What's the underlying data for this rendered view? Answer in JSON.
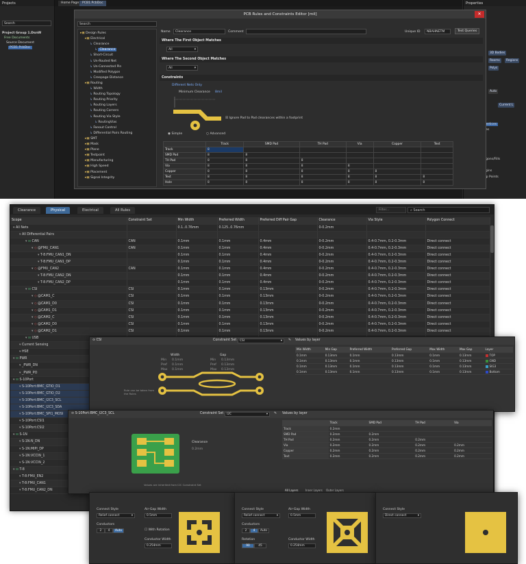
{
  "top": {
    "projects_title": "Projects",
    "project_search": "Search",
    "project_tree": [
      "Project Group 1.DsnW",
      "Free Documents",
      "Source Document",
      "PCB1.PcbDoc"
    ],
    "doc_tabs": [
      "Home Page",
      "PCB1.PcbDoc"
    ],
    "properties_title": "Properties",
    "props_buttons": [
      "3D Bodies",
      "Rooms",
      "Regions",
      "Polys",
      "Other",
      "Auto",
      "Current L"
    ],
    "props_section": "Snapping",
    "props_list": [
      "Objects",
      "Track/Arcs Vertices",
      "Track/Arc Lines",
      "Pad Centers",
      "Pad Vertices",
      "Pad Edges",
      "Via Centers",
      "Regions/Polygons/Fills",
      "Board Shape",
      "Footprint Origins",
      "3D Body Snap Points",
      "Texts"
    ],
    "dialog": {
      "title": "PCB Rules and Constraints Editor [mil]",
      "close": "✕",
      "search": "Search",
      "tree": [
        "Design Rules",
        "Electrical",
        "Clearance",
        "Clearance",
        "Short-Circuit",
        "Un-Routed Net",
        "Un-Connected Pin",
        "Modified Polygon",
        "Creepage Distance",
        "Routing",
        "Width",
        "Routing Topology",
        "Routing Priority",
        "Routing Layers",
        "Routing Corners",
        "Routing Via Style",
        "RoutingVias",
        "Fanout Control",
        "Differential Pairs Routing",
        "SMT",
        "Mask",
        "Plane",
        "Testpoint",
        "Manufacturing",
        "High Speed",
        "Placement",
        "Signal Integrity"
      ],
      "name_label": "Name",
      "name_value": "Clearance",
      "comment_label": "Comment",
      "uid_label": "Unique ID",
      "uid_value": "NBAHNETM",
      "test_queries": "Test Queries",
      "first_match_title": "Where The First Object Matches",
      "first_match_value": "All",
      "second_match_title": "Where The Second Object Matches",
      "second_match_value": "All",
      "constraints_title": "Constraints",
      "diff_nets": "Different Nets Only",
      "min_clearance_label": "Minimum Clearance",
      "min_clearance_value": "8mil",
      "ignore_pad": "Ignore Pad to Pad clearances within a footprint",
      "mode_simple": "Simple",
      "mode_advanced": "Advanced",
      "table_cols": [
        "",
        "Track",
        "SMD Pad",
        "TH Pad",
        "Via",
        "Copper",
        "Text"
      ],
      "table_rows": [
        [
          "Track",
          "8",
          "",
          "",
          "",
          "",
          ""
        ],
        [
          "SMD Pad",
          "8",
          "8",
          "",
          "",
          "",
          ""
        ],
        [
          "TH Pad",
          "8",
          "8",
          "8",
          "",
          "",
          ""
        ],
        [
          "Via",
          "8",
          "8",
          "8",
          "8",
          "",
          ""
        ],
        [
          "Copper",
          "8",
          "8",
          "8",
          "8",
          "8",
          ""
        ],
        [
          "Text",
          "8",
          "8",
          "8",
          "8",
          "8",
          "8"
        ],
        [
          "Hole",
          "8",
          "8",
          "8",
          "8",
          "8",
          "8"
        ]
      ]
    }
  },
  "cm": {
    "tabs": [
      "Clearance",
      "Physical",
      "Electrical",
      "All Rules"
    ],
    "active_tab": "Physical",
    "search": "Search",
    "filter": "Filter...",
    "columns": [
      "Scope",
      "Constraint Set",
      "Min Width",
      "Preferred Width",
      "Preferred Diff Pair Gap",
      "Clearance",
      "Via Style",
      "Polygon Connect"
    ],
    "rows": [
      {
        "d": 0,
        "icon": "",
        "name": "All Nets",
        "cs": "",
        "mw": "0.1..0.76mm",
        "pw": "0.125..0.76mm",
        "gap": "",
        "cl": "0-0.2mm",
        "via": "",
        "pc": ""
      },
      {
        "d": 1,
        "icon": "",
        "name": "All Differential Pairs",
        "cs": "",
        "mw": "",
        "pw": "",
        "gap": "",
        "cl": "",
        "via": "",
        "pc": ""
      },
      {
        "d": 2,
        "icon": "grp",
        "name": "CAN",
        "cs": "CAN",
        "mw": "0.1mm",
        "pw": "0.1mm",
        "gap": "0.4mm",
        "cl": "0-0.2mm",
        "via": "0.4-0.7mm, 0.2-0.3mm",
        "pc": "Direct connect"
      },
      {
        "d": 3,
        "icon": "dif",
        "name": "@FMU_CAN1",
        "cs": "CAN",
        "mw": "0.1mm",
        "pw": "0.1mm",
        "gap": "0.4mm",
        "cl": "0-0.2mm",
        "via": "0.4-0.7mm, 0.2-0.3mm",
        "pc": "Direct connect"
      },
      {
        "d": 4,
        "icon": "",
        "name": "T-8:FMU_CAN1_DN",
        "cs": "",
        "mw": "0.1mm",
        "pw": "0.1mm",
        "gap": "0.4mm",
        "cl": "0-0.2mm",
        "via": "0.4-0.7mm, 0.2-0.3mm",
        "pc": "Direct connect"
      },
      {
        "d": 4,
        "icon": "",
        "name": "T-8:FMU_CAN1_DP",
        "cs": "",
        "mw": "0.1mm",
        "pw": "0.1mm",
        "gap": "0.4mm",
        "cl": "0-0.2mm",
        "via": "0.4-0.7mm, 0.2-0.3mm",
        "pc": "Direct connect"
      },
      {
        "d": 3,
        "icon": "dif",
        "name": "@FMU_CAN2",
        "cs": "CAN",
        "mw": "0.1mm",
        "pw": "0.1mm",
        "gap": "0.4mm",
        "cl": "0-0.2mm",
        "via": "0.4-0.7mm, 0.2-0.3mm",
        "pc": "Direct connect"
      },
      {
        "d": 4,
        "icon": "",
        "name": "T-8:FMU_CAN2_DN",
        "cs": "",
        "mw": "0.1mm",
        "pw": "0.1mm",
        "gap": "0.4mm",
        "cl": "0-0.2mm",
        "via": "0.4-0.7mm, 0.2-0.3mm",
        "pc": "Direct connect"
      },
      {
        "d": 4,
        "icon": "",
        "name": "T-8:FMU_CAN2_DP",
        "cs": "",
        "mw": "0.1mm",
        "pw": "0.1mm",
        "gap": "0.4mm",
        "cl": "0-0.2mm",
        "via": "0.4-0.7mm, 0.2-0.3mm",
        "pc": "Direct connect"
      },
      {
        "d": 2,
        "icon": "grp",
        "name": "CSI",
        "cs": "CSI",
        "mw": "0.1mm",
        "pw": "0.1mm",
        "gap": "0.13mm",
        "cl": "0-0.2mm",
        "via": "0.4-0.7mm, 0.2-0.3mm",
        "pc": "Direct connect"
      },
      {
        "d": 3,
        "icon": "dif",
        "name": "@CAM1_C",
        "cs": "CSI",
        "mw": "0.1mm",
        "pw": "0.1mm",
        "gap": "0.13mm",
        "cl": "0-0.2mm",
        "via": "0.4-0.7mm, 0.2-0.3mm",
        "pc": "Direct connect"
      },
      {
        "d": 3,
        "icon": "dif",
        "name": "@CAM1_D0",
        "cs": "CSI",
        "mw": "0.1mm",
        "pw": "0.1mm",
        "gap": "0.13mm",
        "cl": "0-0.2mm",
        "via": "0.4-0.7mm, 0.2-0.3mm",
        "pc": "Direct connect"
      },
      {
        "d": 3,
        "icon": "dif",
        "name": "@CAM1_D1",
        "cs": "CSI",
        "mw": "0.1mm",
        "pw": "0.1mm",
        "gap": "0.13mm",
        "cl": "0-0.2mm",
        "via": "0.4-0.7mm, 0.2-0.3mm",
        "pc": "Direct connect"
      },
      {
        "d": 3,
        "icon": "dif",
        "name": "@CAM2_C",
        "cs": "CSI",
        "mw": "0.1mm",
        "pw": "0.1mm",
        "gap": "0.13mm",
        "cl": "0-0.2mm",
        "via": "0.4-0.7mm, 0.2-0.3mm",
        "pc": "Direct connect"
      },
      {
        "d": 3,
        "icon": "dif",
        "name": "@CAM2_D0",
        "cs": "CSI",
        "mw": "0.1mm",
        "pw": "0.1mm",
        "gap": "0.13mm",
        "cl": "0-0.2mm",
        "via": "0.4-0.7mm, 0.2-0.3mm",
        "pc": "Direct connect"
      },
      {
        "d": 3,
        "icon": "dif",
        "name": "@CAM2_D1",
        "cs": "CSI",
        "mw": "0.1mm",
        "pw": "0.1mm",
        "gap": "0.13mm",
        "cl": "0-0.2mm",
        "via": "0.4-0.7mm, 0.2-0.3mm",
        "pc": "Direct connect"
      },
      {
        "d": 2,
        "icon": "grp",
        "name": "USB",
        "cs": "",
        "mw": "",
        "pw": "",
        "gap": "",
        "cl": "",
        "via": "",
        "pc": ""
      },
      {
        "d": 1,
        "icon": "",
        "name": "Current Sensing",
        "cs": "",
        "mw": "",
        "pw": "",
        "gap": "",
        "cl": "",
        "via": "",
        "pc": ""
      },
      {
        "d": 1,
        "icon": "",
        "name": "HSE",
        "cs": "",
        "mw": "",
        "pw": "",
        "gap": "",
        "cl": "",
        "via": "",
        "pc": ""
      },
      {
        "d": 0,
        "icon": "grp",
        "name": "PWR",
        "cs": "",
        "mw": "",
        "pw": "",
        "gap": "",
        "cl": "",
        "via": "",
        "pc": ""
      },
      {
        "d": 1,
        "icon": "",
        "name": "_PWR_DN",
        "cs": "",
        "mw": "",
        "pw": "",
        "gap": "",
        "cl": "",
        "via": "",
        "pc": ""
      },
      {
        "d": 1,
        "icon": "",
        "name": "_PWR_PO",
        "cs": "",
        "mw": "",
        "pw": "",
        "gap": "",
        "cl": "",
        "via": "",
        "pc": ""
      },
      {
        "d": 0,
        "icon": "grp",
        "name": "S-10Port",
        "cs": "",
        "mw": "",
        "pw": "",
        "gap": "",
        "cl": "",
        "via": "",
        "pc": ""
      },
      {
        "d": 1,
        "icon": "",
        "name": "S-10Port:BMC_GTIO_D1",
        "cs": "",
        "mw": "",
        "pw": "",
        "gap": "",
        "cl": "",
        "via": "",
        "pc": "",
        "hl": true
      },
      {
        "d": 1,
        "icon": "",
        "name": "S-10Port:BMC_GTIO_D2",
        "cs": "",
        "mw": "",
        "pw": "",
        "gap": "",
        "cl": "",
        "via": "",
        "pc": "",
        "hl": true
      },
      {
        "d": 1,
        "icon": "",
        "name": "S-10Port:BMC_I2C3_SCL",
        "cs": "",
        "mw": "",
        "pw": "",
        "gap": "",
        "cl": "",
        "via": "",
        "pc": "",
        "hl": true
      },
      {
        "d": 1,
        "icon": "",
        "name": "S-10Port:BMC_I2C3_SDA",
        "cs": "",
        "mw": "",
        "pw": "",
        "gap": "",
        "cl": "",
        "via": "",
        "pc": "",
        "hl": true
      },
      {
        "d": 1,
        "icon": "",
        "name": "S-10Port:BMC_SPI1_MOSI",
        "cs": "",
        "mw": "",
        "pw": "",
        "gap": "",
        "cl": "",
        "via": "",
        "pc": "",
        "hl": true
      },
      {
        "d": 1,
        "icon": "",
        "name": "S-10Port:CSI1",
        "cs": "",
        "mw": "",
        "pw": "",
        "gap": "",
        "cl": "",
        "via": "",
        "pc": ""
      },
      {
        "d": 1,
        "icon": "",
        "name": "S-10Port:CSI2",
        "cs": "",
        "mw": "",
        "pw": "",
        "gap": "",
        "cl": "",
        "via": "",
        "pc": ""
      },
      {
        "d": 0,
        "icon": "grp",
        "name": "S-1N",
        "cs": "",
        "mw": "",
        "pw": "",
        "gap": "",
        "cl": "",
        "via": "",
        "pc": ""
      },
      {
        "d": 1,
        "icon": "",
        "name": "S-1N:N_DN",
        "cs": "",
        "mw": "",
        "pw": "",
        "gap": "",
        "cl": "",
        "via": "",
        "pc": ""
      },
      {
        "d": 1,
        "icon": "",
        "name": "S-1N:MIPI_DP",
        "cs": "",
        "mw": "",
        "pw": "",
        "gap": "",
        "cl": "",
        "via": "",
        "pc": ""
      },
      {
        "d": 1,
        "icon": "",
        "name": "S-1N:VCCIN_1",
        "cs": "",
        "mw": "",
        "pw": "",
        "gap": "",
        "cl": "",
        "via": "",
        "pc": ""
      },
      {
        "d": 1,
        "icon": "",
        "name": "S-1N:VCCIN_2",
        "cs": "",
        "mw": "",
        "pw": "",
        "gap": "",
        "cl": "",
        "via": "",
        "pc": ""
      },
      {
        "d": 0,
        "icon": "grp",
        "name": "T-8",
        "cs": "",
        "mw": "",
        "pw": "",
        "gap": "",
        "cl": "",
        "via": "",
        "pc": ""
      },
      {
        "d": 1,
        "icon": "",
        "name": "T-8:FMU_EN2",
        "cs": "",
        "mw": "",
        "pw": "",
        "gap": "",
        "cl": "",
        "via": "",
        "pc": ""
      },
      {
        "d": 1,
        "icon": "",
        "name": "T-8:FMU_CAN1",
        "cs": "",
        "mw": "",
        "pw": "",
        "gap": "",
        "cl": "",
        "via": "",
        "pc": ""
      },
      {
        "d": 1,
        "icon": "",
        "name": "T-8:FMU_CAN2_DN",
        "cs": "",
        "mw": "",
        "pw": "",
        "gap": "",
        "cl": "",
        "via": "",
        "pc": ""
      }
    ]
  },
  "csi_panel": {
    "title": "CSI",
    "constraint_set_label": "Constraint Set",
    "constraint_set": "CSI",
    "width_label": "Width",
    "gap_label": "Gap",
    "width_vals": [
      [
        "Min",
        "0.1mm"
      ],
      [
        "Pref",
        "0.1mm"
      ],
      [
        "Max",
        "0.1mm"
      ]
    ],
    "gap_vals": [
      [
        "Min",
        "0.13mm"
      ],
      [
        "Pref",
        "0.13mm"
      ],
      [
        "Max",
        "0.13mm"
      ]
    ],
    "note": "Rule can be taken from the Rules",
    "layers_title": "Values by layer",
    "layer_cols": [
      "Min Width",
      "Min Gap",
      "Preferred Width",
      "Preferred Gap",
      "Max Width",
      "Max Gap",
      "Layer"
    ],
    "layer_rows": [
      [
        "0.1mm",
        "0.13mm",
        "0.1mm",
        "0.13mm",
        "0.1mm",
        "0.13mm",
        "TOP"
      ],
      [
        "0.1mm",
        "0.13mm",
        "0.1mm",
        "0.13mm",
        "0.1mm",
        "0.13mm",
        "GND"
      ],
      [
        "0.1mm",
        "0.13mm",
        "0.1mm",
        "0.13mm",
        "0.1mm",
        "0.13mm",
        "SIG3"
      ],
      [
        "0.1mm",
        "0.13mm",
        "0.1mm",
        "0.13mm",
        "0.1mm",
        "0.13mm",
        "Bottom"
      ]
    ],
    "layer_colors": [
      "#c33030",
      "#3a8f3a",
      "#3a9fc8",
      "#2c49c6"
    ]
  },
  "i2c_panel": {
    "title": "S-10Port:BMC_I2C3_SCL",
    "constraint_set_label": "Constraint Set",
    "constraint_set": "I2C",
    "clearance_label": "Clearance",
    "clearance_value": "0.2mm",
    "note": "Values are inherited from I2C Constraint Set",
    "layers_title": "Values by layer",
    "layer_cols": [
      "",
      "Track",
      "SMD Pad",
      "TH Pad",
      "Via"
    ],
    "layer_rows": [
      [
        "Track",
        "0.2mm",
        "",
        "",
        ""
      ],
      [
        "SMD Pad",
        "0.2mm",
        "0.2mm",
        "",
        ""
      ],
      [
        "TH Pad",
        "0.2mm",
        "0.2mm",
        "0.2mm",
        ""
      ],
      [
        "Via",
        "0.2mm",
        "0.2mm",
        "0.2mm",
        "0.2mm"
      ],
      [
        "Copper",
        "0.2mm",
        "0.2mm",
        "0.2mm",
        "0.2mm"
      ],
      [
        "Text",
        "0.2mm",
        "0.2mm",
        "0.2mm",
        "0.2mm"
      ]
    ],
    "bottom_tabs": [
      "All Layers",
      "Inner Layers",
      "Outer Layers"
    ]
  },
  "poly_panels": [
    {
      "connect_style_label": "Connect Style",
      "connect_style": "Relief connect",
      "air_gap_label": "Air-Gap Width",
      "air_gap": "0.5mm",
      "conductors_label": "Conductors",
      "conductors": [
        "2",
        "4",
        "Auto"
      ],
      "conductors_on": 2,
      "with_rotation": "With Rotation",
      "conductor_width_label": "Conductor Width",
      "conductor_width": "0.254mm"
    },
    {
      "connect_style_label": "Connect Style",
      "connect_style": "Relief connect",
      "air_gap_label": "Air-Gap Width",
      "air_gap": "0.5mm",
      "conductors_label": "Conductors",
      "conductors": [
        "2",
        "4",
        "Auto"
      ],
      "conductors_on": 1,
      "rotation_label": "Rotation",
      "rotation": [
        "90",
        "45"
      ],
      "rotation_on": 0,
      "conductor_width_label": "Conductor Width",
      "conductor_width": "0.254mm"
    },
    {
      "connect_style_label": "Connect Style",
      "connect_style": "Direct connect"
    }
  ],
  "colors": {
    "accent": "#3d6897",
    "copper": "#e5c242",
    "pcb_green": "#3aa04a"
  }
}
